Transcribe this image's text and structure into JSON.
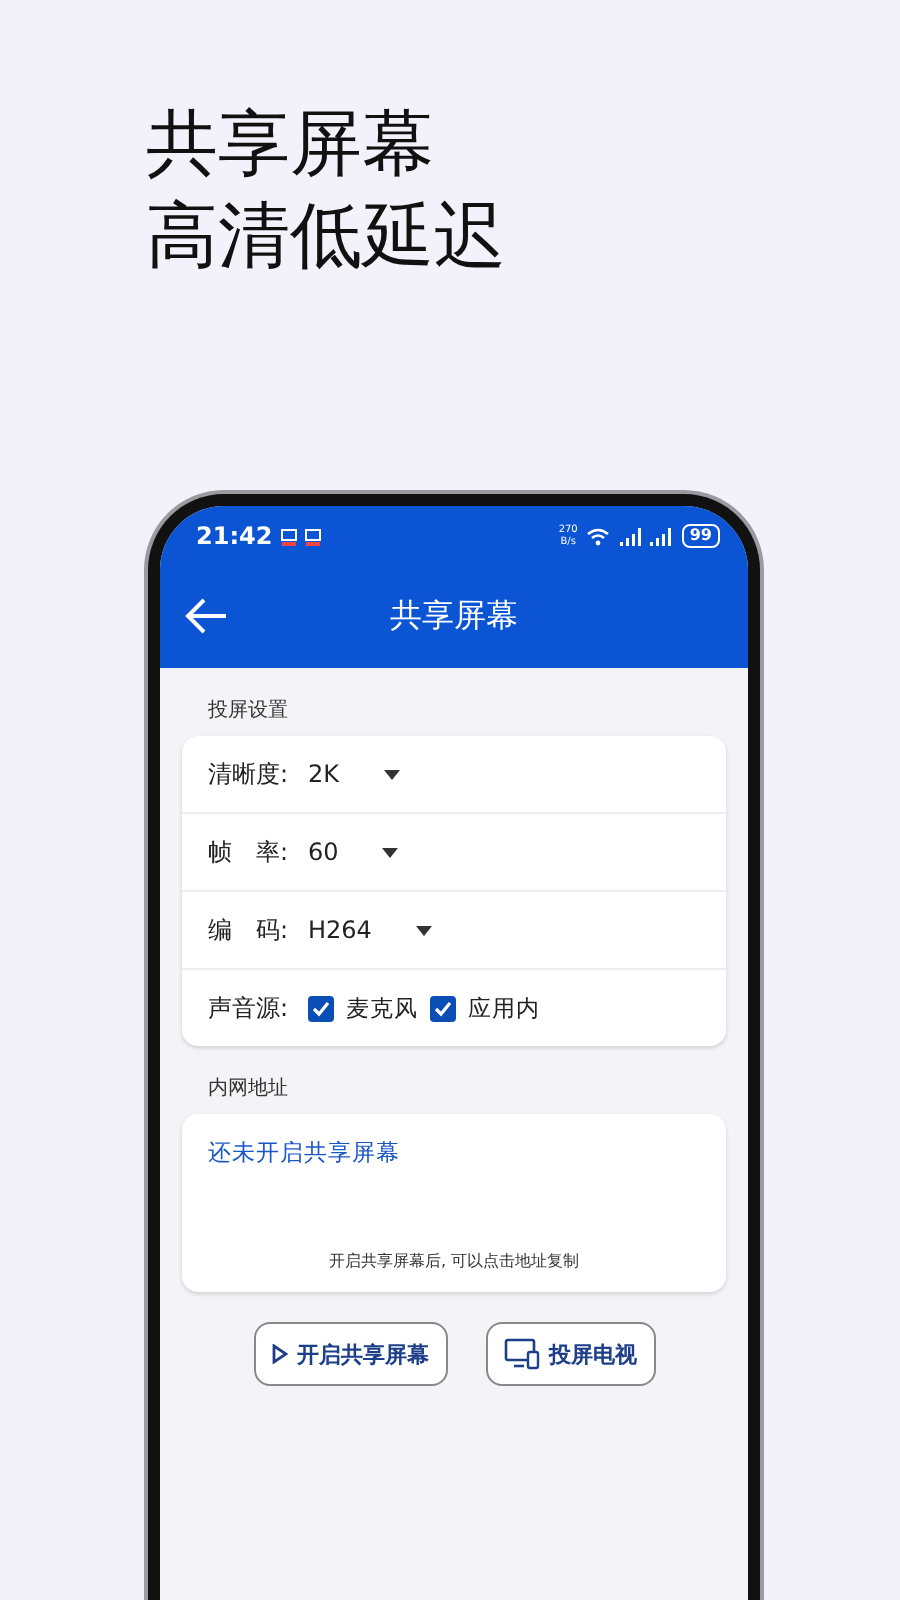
{
  "headline": [
    "共享屏幕",
    "高清低延迟"
  ],
  "status_bar": {
    "time": "21:42",
    "net_speed": "270",
    "net_speed_unit": "B/s",
    "battery": "99"
  },
  "toolbar": {
    "title": "共享屏幕"
  },
  "settings": {
    "title": "投屏设置",
    "rows": [
      {
        "kind": "select",
        "label": "清晰度:",
        "value": "2K"
      },
      {
        "kind": "select",
        "label": "帧　率:",
        "value": "60"
      },
      {
        "kind": "select",
        "label": "编　码:",
        "value": "H264"
      },
      {
        "kind": "checkboxes",
        "label": "声音源:",
        "options": [
          {
            "label": "麦克风",
            "checked": true
          },
          {
            "label": "应用内",
            "checked": true
          }
        ]
      }
    ]
  },
  "address": {
    "title": "内网地址",
    "status": "还未开启共享屏幕",
    "hint": "开启共享屏幕后, 可以点击地址复制"
  },
  "buttons": [
    {
      "kind": "play",
      "label": "开启共享屏幕"
    },
    {
      "kind": "tv",
      "label": "投屏电视"
    }
  ]
}
